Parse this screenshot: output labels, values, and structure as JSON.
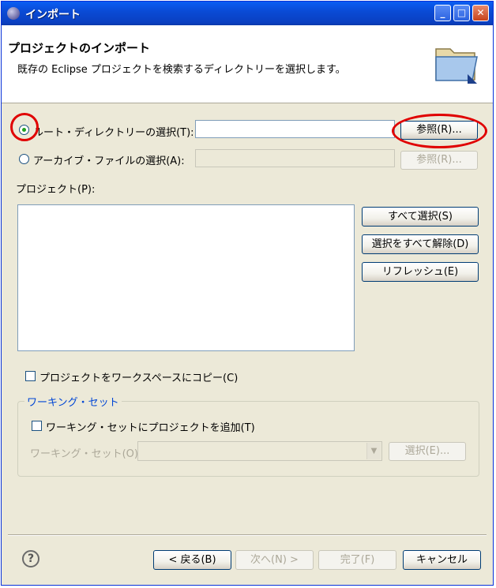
{
  "window": {
    "title": "インポート",
    "min_glyph": "_",
    "max_glyph": "□",
    "close_glyph": "✕"
  },
  "header": {
    "title": "プロジェクトのインポート",
    "description": "既存の Eclipse プロジェクトを検索するディレクトリーを選択します。"
  },
  "source": {
    "root_label": "ルート・ディレクトリーの選択(T):",
    "root_value": "",
    "root_browse": "参照(R)...",
    "archive_label": "アーカイブ・ファイルの選択(A):",
    "archive_value": "",
    "archive_browse": "参照(R)..."
  },
  "projects": {
    "label": "プロジェクト(P):",
    "select_all": "すべて選択(S)",
    "deselect_all": "選択をすべて解除(D)",
    "refresh": "リフレッシュ(E)",
    "copy_label": "プロジェクトをワークスペースにコピー(C)"
  },
  "working_set": {
    "group_title": "ワーキング・セット",
    "add_label": "ワーキング・セットにプロジェクトを追加(T)",
    "set_label": "ワーキング・セット(O):",
    "select_button": "選択(E)..."
  },
  "footer": {
    "help_glyph": "?",
    "back": "< 戻る(B)",
    "next": "次へ(N) >",
    "finish": "完了(F)",
    "cancel": "キャンセル"
  },
  "colors": {
    "titlebar": "#0a4bd6",
    "accent_ring": "#e00000",
    "group_title": "#0046d5"
  }
}
